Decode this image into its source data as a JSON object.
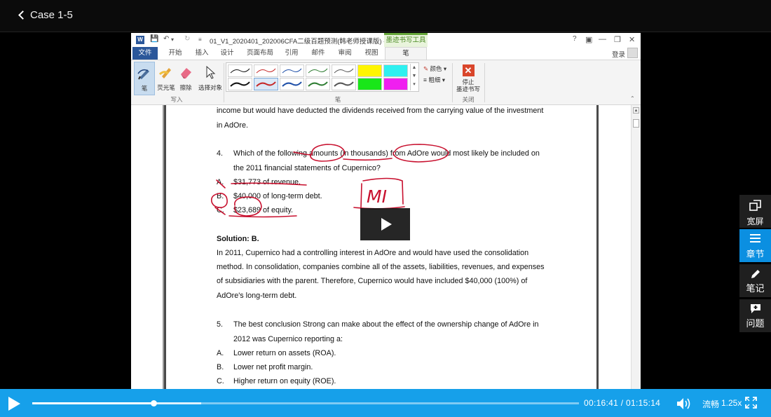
{
  "header": {
    "title": "Case 1-5"
  },
  "word": {
    "logo": "W",
    "doc_title": "01_V1_2020401_202006CFA二级百题预测(韩老师授课版) - ...",
    "context_tool": "墨迹书写工具",
    "help": "?",
    "tabs": [
      {
        "label": "文件"
      },
      {
        "label": "开始"
      },
      {
        "label": "插入"
      },
      {
        "label": "设计"
      },
      {
        "label": "页面布局"
      },
      {
        "label": "引用"
      },
      {
        "label": "邮件"
      },
      {
        "label": "审阅"
      },
      {
        "label": "视图"
      },
      {
        "label": "笔"
      }
    ],
    "login": "登录",
    "ribbon": {
      "tools": [
        {
          "label": "笔"
        },
        {
          "label": "荧光笔"
        },
        {
          "label": "擦除"
        },
        {
          "label": "选择对象"
        }
      ],
      "group_write": "写入",
      "group_pens": "笔",
      "color_label": "颜色",
      "weight_label": "粗细",
      "stop_label_1": "停止",
      "stop_label_2": "墨迹书写",
      "group_close": "关闭"
    }
  },
  "document": {
    "lines": {
      "l1": "income but would have deducted the dividends received from the carrying value of the investment",
      "l2": "in AdOre.",
      "q4_num": "4.",
      "q4_a": "Which of the following amounts (in thousands) from AdOre would most likely be included on",
      "q4_b": "the 2011 financial statements of Cupernico?",
      "optA_letter": "A.",
      "optA": "$31,773 of revenue.",
      "optB_letter": "B.",
      "optB": "$40,000 of long-term debt.",
      "optC_letter": "C.",
      "optC": "$23,689 of equity.",
      "solution": "Solution: B.",
      "sol1": "In 2011, Cupernico had a controlling interest in AdOre and would have used the consolidation",
      "sol2": "method. In consolidation, companies combine all of the assets, liabilities, revenues, and expenses",
      "sol3": "of subsidiaries with the parent. Therefore, Cupernico would have included $40,000 (100%) of",
      "sol4": "AdOre's long-term debt.",
      "q5_num": "5.",
      "q5_a": "The best conclusion Strong can make about the effect of the ownership change of AdOre in",
      "q5_b": "2012 was Cupernico reporting a:",
      "q5A_letter": "A.",
      "q5A": "Lower return on assets (ROA).",
      "q5B_letter": "B.",
      "q5B": "Lower net profit margin.",
      "q5C_letter": "C.",
      "q5C": "Higher return on equity (ROE)."
    },
    "annotation": "MI"
  },
  "side_panel": [
    {
      "label": "宽屏",
      "icon": "widescreen-icon"
    },
    {
      "label": "章节",
      "icon": "menu-icon"
    },
    {
      "label": "笔记",
      "icon": "pencil-icon"
    },
    {
      "label": "问题",
      "icon": "question-chat-icon"
    }
  ],
  "player": {
    "current_time": "00:16:41",
    "separator": "/",
    "duration": "01:15:14",
    "progress_fraction": 0.222,
    "buffered_fraction": 0.309,
    "quality": "流畅",
    "speed": "1.25x",
    "accent_color": "#16a0ea"
  }
}
